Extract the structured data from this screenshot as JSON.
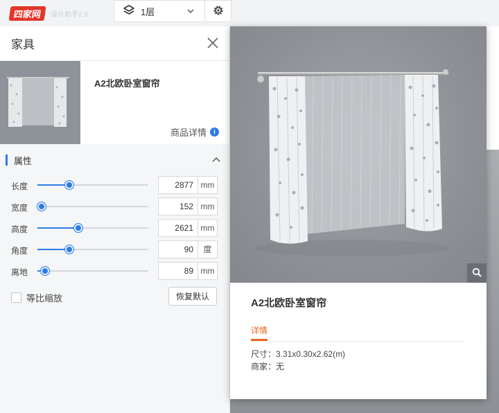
{
  "topbar": {
    "logo_text": "四家网",
    "logo_sub": "设计助手2.0",
    "floor_label": "1层"
  },
  "panel": {
    "title": "家具",
    "product_name": "A2北欧卧室窗帘",
    "detail_link": "商品详情",
    "detail_icon": "i",
    "section_title": "属性",
    "properties": [
      {
        "label": "长度",
        "value": "2877",
        "unit": "mm",
        "level": 0.25
      },
      {
        "label": "宽度",
        "value": "152",
        "unit": "mm",
        "level": 0.0
      },
      {
        "label": "高度",
        "value": "2621",
        "unit": "mm",
        "level": 0.33
      },
      {
        "label": "角度",
        "value": "90",
        "unit": "度",
        "level": 0.25
      },
      {
        "label": "离地",
        "value": "89",
        "unit": "mm",
        "level": 0.03
      }
    ],
    "proportional_label": "等比缩放",
    "reset_label": "恢复默认"
  },
  "popup": {
    "title": "A2北欧卧室窗帘",
    "tab_label": "详情",
    "size_text": "尺寸：3.31x0.30x2.62(m)",
    "vendor_text": "商家：无"
  },
  "colors": {
    "accent": "#2d7be5",
    "tab_active": "#e8681f",
    "logo_red": "#e2372b"
  }
}
